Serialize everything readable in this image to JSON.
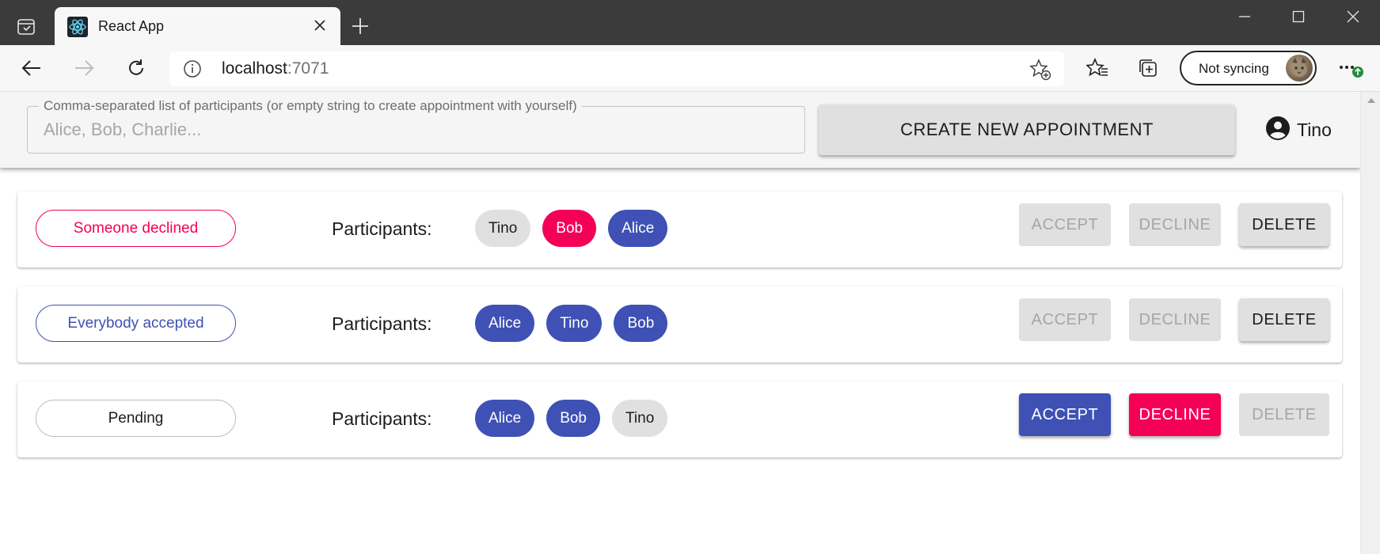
{
  "browser": {
    "tab_title": "React App",
    "url_host": "localhost",
    "url_port": ":7071",
    "sync_label": "Not syncing"
  },
  "app": {
    "participants_field_label": "Comma-separated list of participants (or empty string to create appointment with yourself)",
    "participants_field_placeholder": "Alice, Bob, Charlie...",
    "participants_field_value": "",
    "create_button_label": "CREATE NEW APPOINTMENT",
    "current_user": "Tino",
    "participants_label": "Participants:",
    "button_labels": {
      "accept": "ACCEPT",
      "decline": "DECLINE",
      "delete": "DELETE"
    },
    "appointments": [
      {
        "status": "Someone declined",
        "status_kind": "declined",
        "participants": [
          {
            "name": "Tino",
            "state": "neutral"
          },
          {
            "name": "Bob",
            "state": "declined"
          },
          {
            "name": "Alice",
            "state": "accepted"
          }
        ],
        "accept_enabled": false,
        "decline_enabled": false,
        "delete_enabled": true
      },
      {
        "status": "Everybody accepted",
        "status_kind": "accepted",
        "participants": [
          {
            "name": "Alice",
            "state": "accepted"
          },
          {
            "name": "Tino",
            "state": "accepted"
          },
          {
            "name": "Bob",
            "state": "accepted"
          }
        ],
        "accept_enabled": false,
        "decline_enabled": false,
        "delete_enabled": true
      },
      {
        "status": "Pending",
        "status_kind": "pending",
        "participants": [
          {
            "name": "Alice",
            "state": "accepted"
          },
          {
            "name": "Bob",
            "state": "accepted"
          },
          {
            "name": "Tino",
            "state": "neutral"
          }
        ],
        "accept_enabled": true,
        "decline_enabled": true,
        "delete_enabled": false
      }
    ]
  },
  "colors": {
    "primary": "#3f51b5",
    "secondary": "#f50057",
    "neutral_chip": "#e0e0e0",
    "titlebar": "#3b3b3b"
  },
  "icons": {
    "tab_favicon": "react-icon",
    "user": "account-circle-icon"
  }
}
